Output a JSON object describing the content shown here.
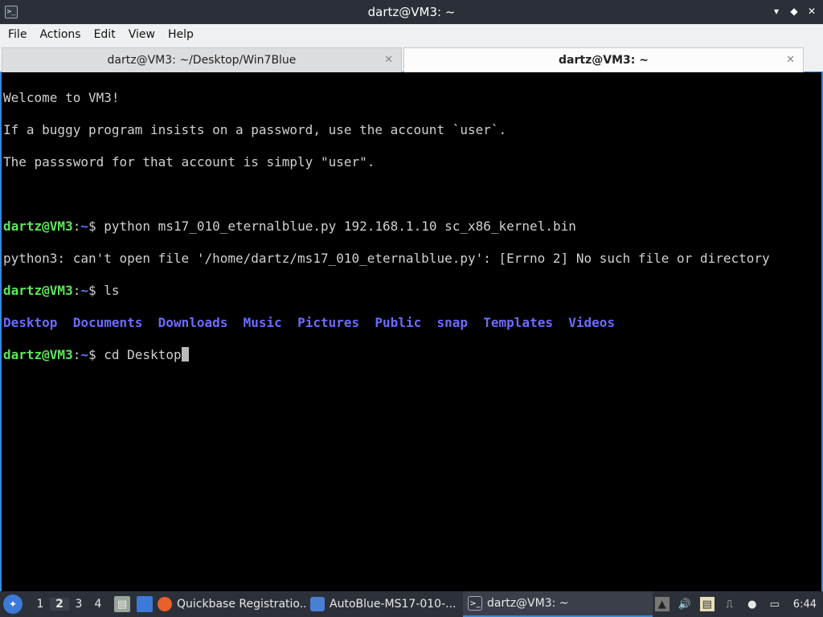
{
  "window": {
    "title": "dartz@VM3: ~",
    "minimize_icon": "▾",
    "maximize_icon": "◆",
    "close_icon": "✕"
  },
  "menu": [
    "File",
    "Actions",
    "Edit",
    "View",
    "Help"
  ],
  "tabs": [
    {
      "label": "dartz@VM3: ~/Desktop/Win7Blue",
      "active": false
    },
    {
      "label": "dartz@VM3: ~",
      "active": true
    }
  ],
  "terminal": {
    "motd": [
      "Welcome to VM3!",
      "If a buggy program insists on a password, use the account `user`.",
      "The passsword for that account is simply \"user\"."
    ],
    "prompt_user": "dartz@VM3",
    "prompt_sep": ":",
    "prompt_path": "~",
    "prompt_symbol": "$ ",
    "cmd1": "python ms17_010_eternalblue.py 192.168.1.10 sc_x86_kernel.bin",
    "error1": "python3: can't open file '/home/dartz/ms17_010_eternalblue.py': [Errno 2] No such file or directory",
    "cmd2": "ls",
    "ls_output": [
      "Desktop",
      "Documents",
      "Downloads",
      "Music",
      "Pictures",
      "Public",
      "snap",
      "Templates",
      "Videos"
    ],
    "cmd3": "cd Desktop"
  },
  "taskbar": {
    "desktops": [
      "1",
      "2",
      "3",
      "4"
    ],
    "current_desktop": "2",
    "tasks": [
      {
        "label": "Quickbase Registratio...",
        "icon": "firefox-icon"
      },
      {
        "label": "AutoBlue-MS17-010-...",
        "icon": "folder-icon"
      },
      {
        "label": "dartz@VM3: ~",
        "icon": "terminal-icon"
      }
    ],
    "clock": "6:44"
  },
  "colors": {
    "prompt_user": "#5ce65c",
    "prompt_path": "#5a7cff",
    "directory": "#6b6bff",
    "accent": "#3a88d6"
  }
}
